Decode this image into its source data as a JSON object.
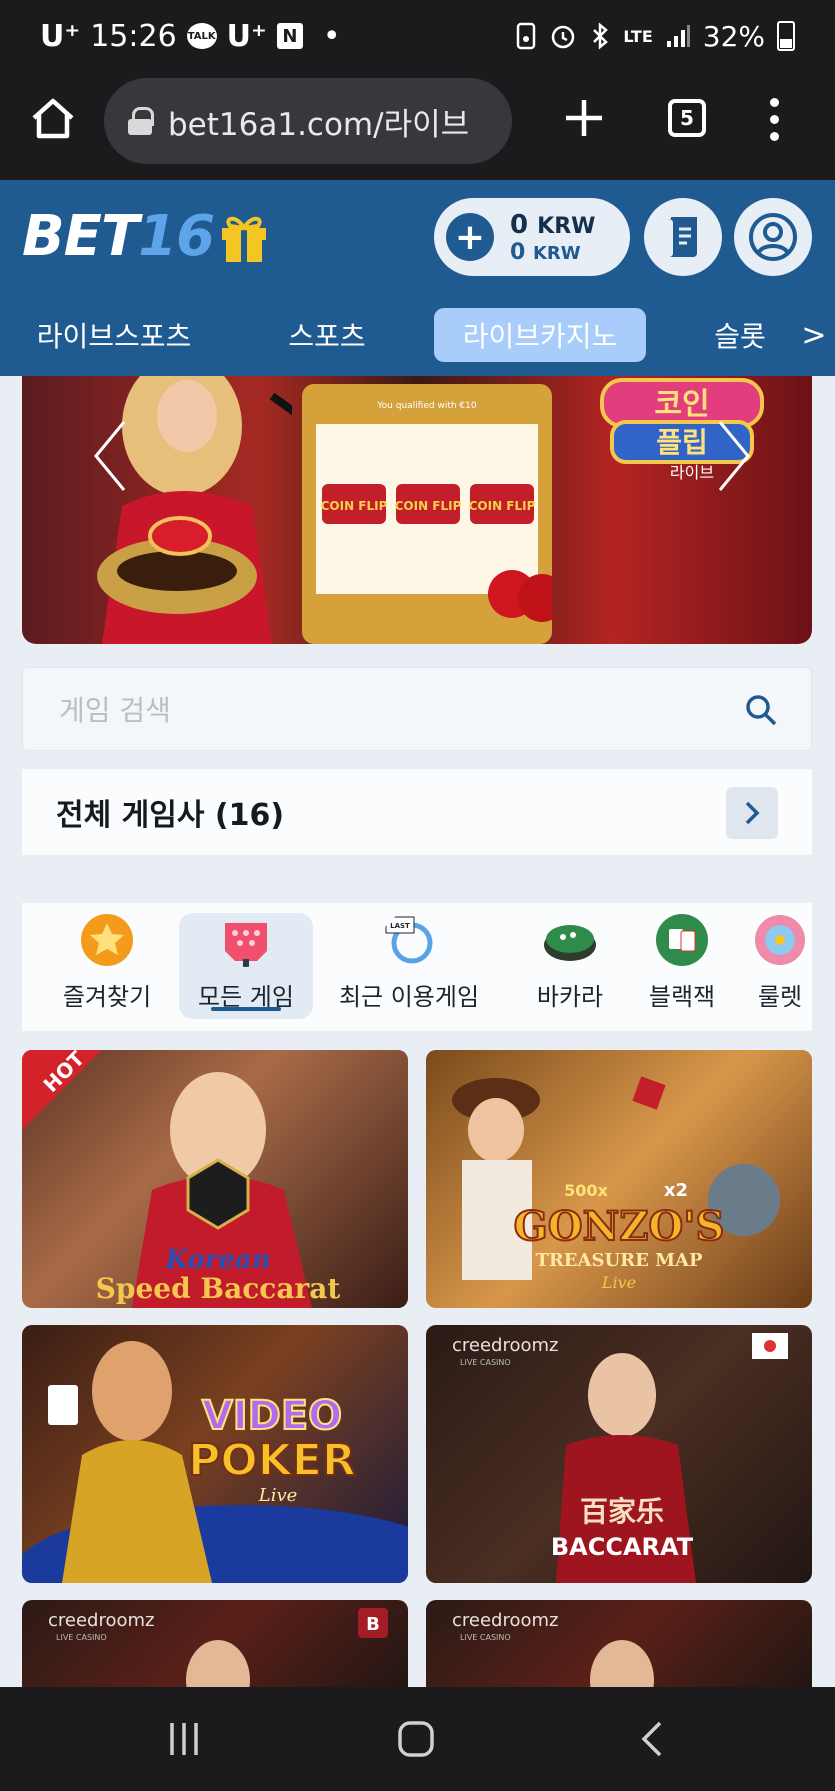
{
  "status_bar": {
    "carrier": "U⁺",
    "time": "15:26",
    "talk_badge": "TALK",
    "carrier2": "U⁺",
    "n_badge": "N",
    "dot": "•",
    "network": "LTE",
    "battery": "32%"
  },
  "browser": {
    "url": "bet16a1.com/라이브",
    "tab_count": "5"
  },
  "header": {
    "logo_text": "BET",
    "logo_num": "16",
    "balance_main": "0",
    "balance_main_unit": "KRW",
    "balance_bonus": "0",
    "balance_bonus_unit": "KRW"
  },
  "category_nav": {
    "items": [
      "라이브스포츠",
      "스포츠",
      "라이브카지노",
      "슬롯"
    ],
    "active_index": 2,
    "more": ">"
  },
  "banner": {
    "qualified_text": "You qualified with €10",
    "brand_line1": "코인",
    "brand_line2": "플립",
    "brand_sub": "라이브",
    "reel_labels": [
      "COIN FLIP",
      "COIN FLIP",
      "COIN FLIP"
    ]
  },
  "search": {
    "placeholder": "게임 검색"
  },
  "providers": {
    "label": "전체 게임사 (16)"
  },
  "game_categories": [
    {
      "label": "즐겨찾기",
      "icon": "star-icon"
    },
    {
      "label": "모든 게임",
      "icon": "all-games-icon"
    },
    {
      "label": "최근 이용게임",
      "icon": "last-played-icon"
    },
    {
      "label": "바카라",
      "icon": "baccarat-table-icon"
    },
    {
      "label": "블랙잭",
      "icon": "blackjack-cards-icon"
    },
    {
      "label": "룰렛",
      "icon": "roulette-wheel-icon"
    }
  ],
  "game_categories_active": 1,
  "games": [
    {
      "name_line1": "Korean",
      "name_line2": "Speed Baccarat",
      "badge": "HOT"
    },
    {
      "name_line1": "GONZO'S",
      "name_line2": "TREASURE MAP",
      "sub": "Live",
      "mult1": "500x",
      "mult2": "x2"
    },
    {
      "name_line1": "VIDEO",
      "name_line2": "POKER",
      "sub": "Live"
    },
    {
      "brand": "creedroomz",
      "brand_sub": "LIVE CASINO",
      "name_line1": "百家乐",
      "name_line2": "BACCARAT"
    },
    {
      "brand": "creedroomz",
      "brand_sub": "LIVE CASINO",
      "badge": "B"
    },
    {
      "brand": "creedroomz",
      "brand_sub": "LIVE CASINO"
    }
  ]
}
